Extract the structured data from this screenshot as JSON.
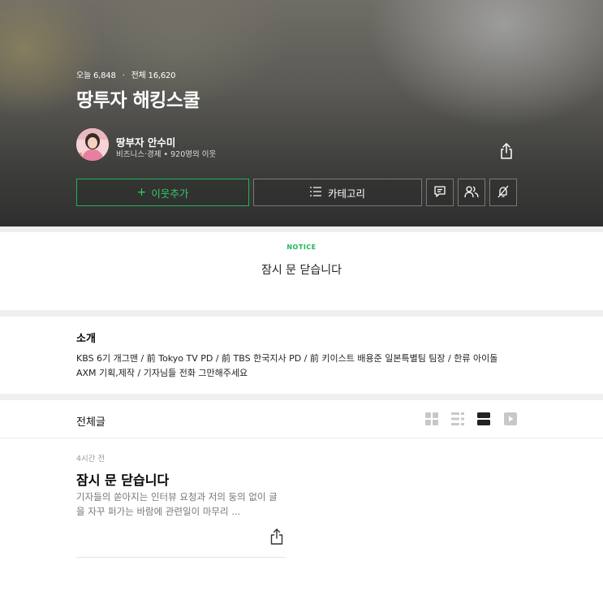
{
  "header": {
    "stats_today": "오늘 6,848",
    "stats_separator": "·",
    "stats_total": "전체 16,620",
    "blog_title": "땅투자 해킹스쿨"
  },
  "owner": {
    "name": "땅부자 안수미",
    "meta": "비즈니스·경제 • 920명의 이웃"
  },
  "buttons": {
    "add_neighbor_plus": "+",
    "add_neighbor": "이웃추가",
    "category": "카테고리"
  },
  "icons": {
    "share": "share-icon",
    "menu": "menu-list-icon",
    "chat": "chat-icon",
    "neighbors": "neighbors-icon",
    "notify_off": "notification-off-icon",
    "view_album": "album-grid-icon",
    "view_list": "list-view-icon",
    "view_card": "card-view-icon",
    "view_video": "video-view-icon"
  },
  "notice": {
    "label": "NOTICE",
    "text": "잠시 문 닫습니다"
  },
  "intro": {
    "heading": "소개",
    "body": "KBS 6기 개그맨 / 前 Tokyo TV PD / 前 TBS 한국지사 PD / 前 키이스트 배용준 일본특별팀 팀장 / 한류 아이돌 AXM 기획,제작 / 기자님들 전화 그만해주세요"
  },
  "posts": {
    "heading": "전체글",
    "items": [
      {
        "time": "4시간 전",
        "title": "잠시 문 닫습니다",
        "excerpt": "기자들의 쏟아지는 인터뷰 요청과 저의 둥의 없이 글을 자꾸 퍼가는 바람에 관련일이 마무리 ..."
      }
    ]
  },
  "colors": {
    "accent_green": "#1fb55a",
    "hero_dark": "#2f2f2f",
    "divider": "#efefef"
  }
}
